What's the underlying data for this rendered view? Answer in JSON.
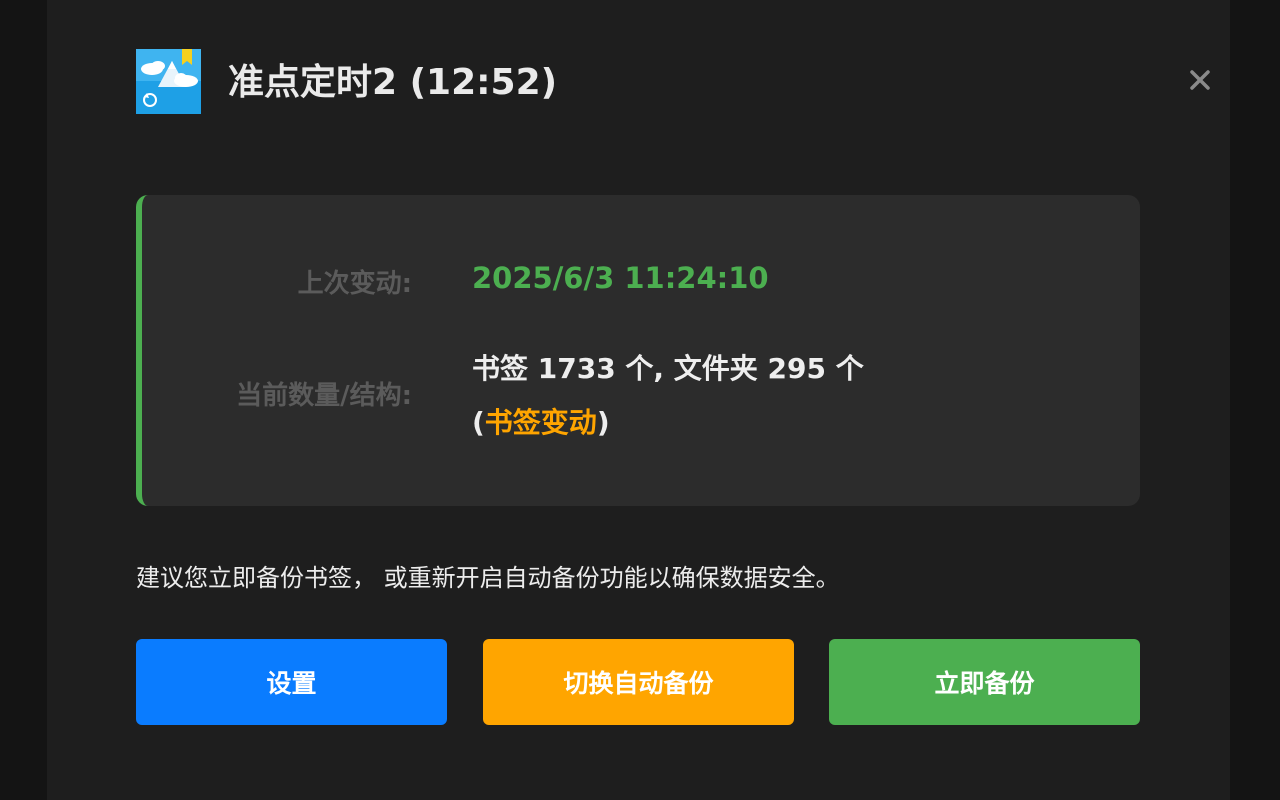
{
  "dialog": {
    "title": "准点定时2 (12:52)",
    "app_icon": "bookmark-cloud-app-icon",
    "close_icon": "close-icon"
  },
  "info": {
    "last_change_label": "上次变动:",
    "last_change_value": "2025/6/3 11:24:10",
    "count_label": "当前数量/结构:",
    "count_value": "书签 1733 个, 文件夹 295 个",
    "change_open": "(",
    "change_text": "书签变动",
    "change_close": ")"
  },
  "notice": "建议您立即备份书签， 或重新开启自动备份功能以确保数据安全。",
  "buttons": {
    "settings": "设置",
    "toggle_auto": "切换自动备份",
    "backup_now": "立即备份"
  },
  "colors": {
    "accent_green": "#4caf50",
    "accent_orange": "#ffa500",
    "accent_blue": "#0a7cff"
  }
}
